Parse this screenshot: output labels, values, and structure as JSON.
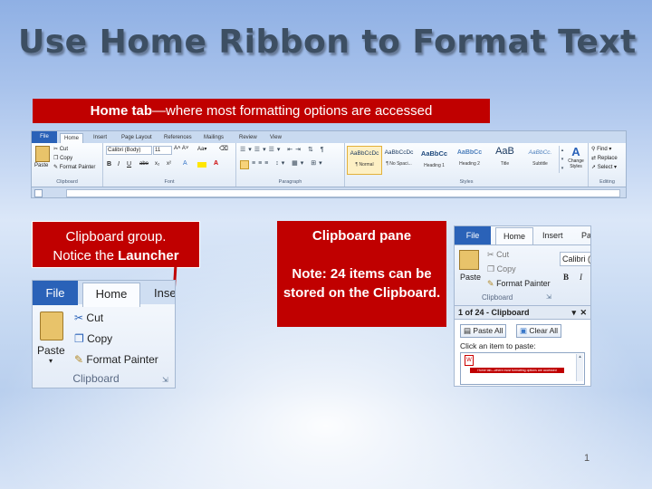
{
  "slide": {
    "title": "Use Home Ribbon to Format Text",
    "page_number": "1"
  },
  "callouts": {
    "home_tab_bold": "Home tab",
    "home_tab_rest": "—where most formatting options are accessed",
    "clipboard_group_line1": "Clipboard group.",
    "clipboard_group_line2": "Notice the ",
    "clipboard_group_bold": "Launcher",
    "pane_title": "Clipboard pane",
    "pane_note": "Note: 24 items can be stored on the Clipboard."
  },
  "ribbon": {
    "tabs": [
      "File",
      "Home",
      "Insert",
      "Page Layout",
      "References",
      "Mailings",
      "Review",
      "View"
    ],
    "clipboard": {
      "paste": "Paste",
      "cut": "Cut",
      "copy": "Copy",
      "format_painter": "Format Painter",
      "label": "Clipboard"
    },
    "font": {
      "name": "Calibri (Body)",
      "size": "11",
      "label": "Font"
    },
    "paragraph": {
      "label": "Paragraph"
    },
    "styles": {
      "label": "Styles",
      "items": [
        {
          "sample": "AaBbCcDc",
          "name": "¶ Normal"
        },
        {
          "sample": "AaBbCcDc",
          "name": "¶ No Spaci..."
        },
        {
          "sample": "AaBbCc",
          "name": "Heading 1"
        },
        {
          "sample": "AaBbCc",
          "name": "Heading 2"
        },
        {
          "sample": "AaB",
          "name": "Title"
        },
        {
          "sample": "AaBbCc.",
          "name": "Subtitle"
        }
      ],
      "change_styles": "Change Styles"
    },
    "editing": {
      "find": "Find",
      "replace": "Replace",
      "select": "Select",
      "label": "Editing"
    }
  },
  "clipboard_zoom": {
    "file": "File",
    "home": "Home",
    "insert": "Inse",
    "paste": "Paste",
    "cut": "Cut",
    "copy": "Copy",
    "format_painter": "Format Painter",
    "label": "Clipboard"
  },
  "clipboard_pane": {
    "file": "File",
    "home": "Home",
    "insert": "Insert",
    "pa": "Pa",
    "font": "Calibri (",
    "cut": "Cut",
    "copy": "Copy",
    "paste": "Paste",
    "format_painter": "Format Painter",
    "group_label": "Clipboard",
    "header": "1 of 24 - Clipboard",
    "paste_all": "Paste All",
    "clear_all": "Clear All",
    "instruction": "Click an item to paste:",
    "item_text": "Home tab—where most formatting options are accessed"
  },
  "colors": {
    "callout_red": "#c00000",
    "file_blue": "#2a62b8",
    "title": "#3d4f63"
  }
}
